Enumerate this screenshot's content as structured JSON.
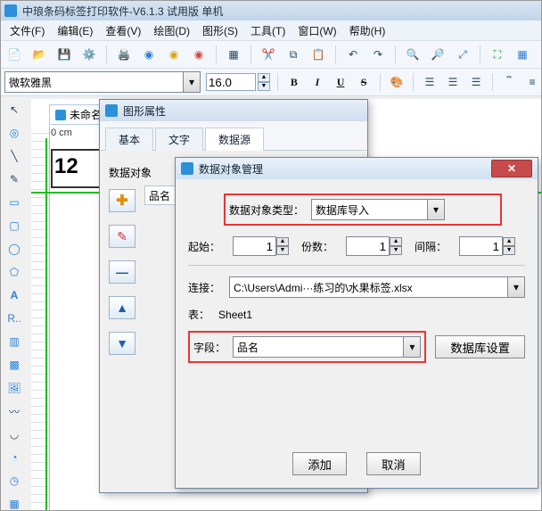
{
  "window_title": "中琅条码标签打印软件-V6.1.3 试用版 单机",
  "menus": [
    "文件(F)",
    "编辑(E)",
    "查看(V)",
    "绘图(D)",
    "图形(S)",
    "工具(T)",
    "窗口(W)",
    "帮助(H)"
  ],
  "font_name": "微软雅黑",
  "font_size": "16.0",
  "text_styles": {
    "bold": "B",
    "italic": "I",
    "underline": "U",
    "strike": "S"
  },
  "doc_tab": "未命名",
  "ruler_origin": "0 cm",
  "sample_number": "12",
  "props_win": {
    "title": "图形属性",
    "tabs": [
      "基本",
      "文字",
      "数据源"
    ],
    "active_tab_index": 2,
    "data_objects_label": "数据对象",
    "second_label": "品名"
  },
  "mgmt_win": {
    "title": "数据对象管理",
    "type_label": "数据对象类型：",
    "type_value": "数据库导入",
    "start_label": "起始：",
    "start_value": "1",
    "count_label": "份数：",
    "count_value": "1",
    "gap_label": "间隔：",
    "gap_value": "1",
    "conn_label": "连接：",
    "conn_value": "C:\\Users\\Admi···练习的\\水果标签.xlsx",
    "table_label": "表：",
    "table_value": "Sheet1",
    "field_label": "字段：",
    "field_value": "品名",
    "db_settings_btn": "数据库设置",
    "add_btn": "添加",
    "cancel_btn": "取消"
  }
}
